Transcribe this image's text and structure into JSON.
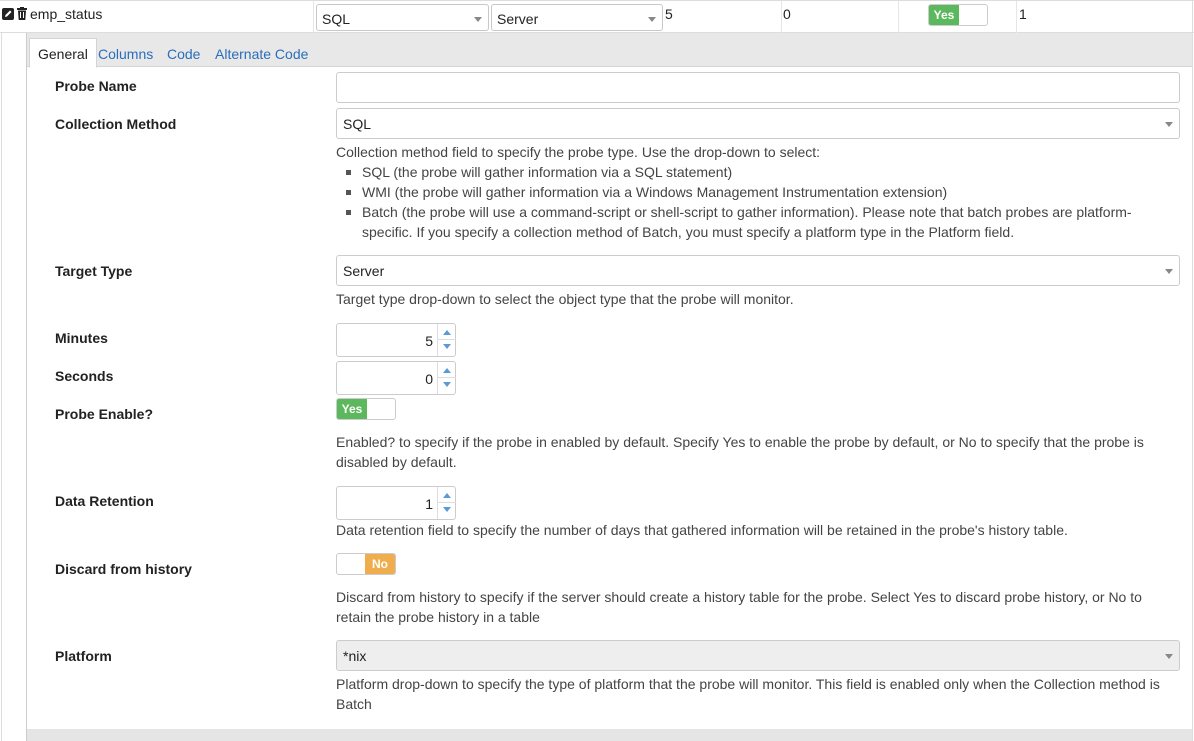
{
  "row": {
    "name": "emp_status",
    "collection_method": "SQL",
    "target_type": "Server",
    "minutes": "5",
    "seconds": "0",
    "enabled_label": "Yes",
    "data_retention": "1"
  },
  "tabs": [
    {
      "label": "General"
    },
    {
      "label": "Columns"
    },
    {
      "label": "Code"
    },
    {
      "label": "Alternate Code"
    }
  ],
  "form": {
    "probe_name": {
      "label": "Probe Name",
      "value": ""
    },
    "collection_method": {
      "label": "Collection Method",
      "value": "SQL",
      "help_intro": "Collection method field to specify the probe type. Use the drop-down to select:",
      "help_items": [
        "SQL (the probe will gather information via a SQL statement)",
        "WMI (the probe will gather information via a Windows Management Instrumentation extension)",
        "Batch (the probe will use a command-script or shell-script to gather information). Please note that batch probes are platform-specific. If you specify a collection method of Batch, you must specify a platform type in the Platform field."
      ]
    },
    "target_type": {
      "label": "Target Type",
      "value": "Server",
      "help": "Target type drop-down to select the object type that the probe will monitor."
    },
    "minutes": {
      "label": "Minutes",
      "value": "5"
    },
    "seconds": {
      "label": "Seconds",
      "value": "0"
    },
    "probe_enable": {
      "label": "Probe Enable?",
      "toggle": "Yes",
      "help": "Enabled? to specify if the probe in enabled by default. Specify Yes to enable the probe by default, or No to specify that the probe is disabled by default."
    },
    "data_retention": {
      "label": "Data Retention",
      "value": "1",
      "help": "Data retention field to specify the number of days that gathered information will be retained in the probe's history table."
    },
    "discard_history": {
      "label": "Discard from history",
      "toggle": "No",
      "help": "Discard from history to specify if the server should create a history table for the probe. Select Yes to discard probe history, or No to retain the probe history in a table"
    },
    "platform": {
      "label": "Platform",
      "value": "*nix",
      "help": "Platform drop-down to specify the type of platform that the probe will monitor. This field is enabled only when the Collection method is Batch"
    }
  },
  "colors": {
    "toggle_yes": "#5cb85c",
    "toggle_no": "#f0ad4e",
    "link": "#2a6ebb"
  },
  "icons": [
    "edit-icon",
    "trash-icon",
    "chevron-down-icon",
    "spinner-up-icon",
    "spinner-down-icon"
  ]
}
